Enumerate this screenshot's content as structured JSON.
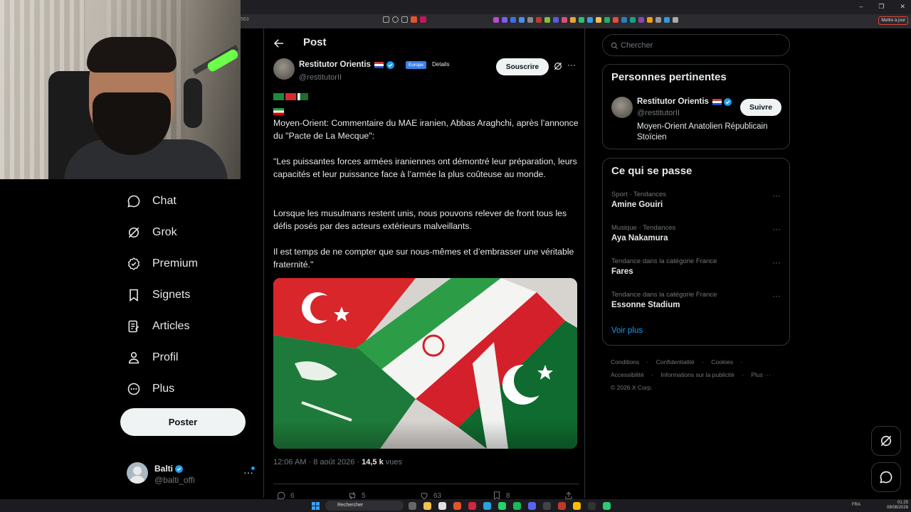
{
  "browser": {
    "url_fragment": "563",
    "update_label": "Mettre à jour",
    "colors": {
      "accent": "#1d9bf0",
      "background": "#000000",
      "border": "#2f3336",
      "muted": "#71767b",
      "text": "#e7e9ea"
    }
  },
  "nav": {
    "items": [
      {
        "label": "Chat",
        "icon": "chat-bubble-icon"
      },
      {
        "label": "Grok",
        "icon": "grok-icon"
      },
      {
        "label": "Premium",
        "icon": "verified-badge-icon"
      },
      {
        "label": "Signets",
        "icon": "bookmark-icon"
      },
      {
        "label": "Articles",
        "icon": "article-icon"
      },
      {
        "label": "Profil",
        "icon": "person-icon"
      },
      {
        "label": "Plus",
        "icon": "more-circle-icon"
      }
    ],
    "post_label": "Poster"
  },
  "account": {
    "name": "Balti",
    "handle": "@balti_offi",
    "more": "···"
  },
  "post": {
    "title": "Post",
    "author": {
      "name": "Restitutor Orientis",
      "handle": "@restitutorII",
      "badge": "Europe",
      "details": "Details"
    },
    "subscribe_label": "Souscrire",
    "more": "···",
    "paragraphs": [
      "Moyen-Orient: Commentaire du MAE iranien, Abbas Araghchi, après l’annonce du \"Pacte de La Mecque\":",
      "\"Les puissantes forces armées iraniennes ont démontré leur préparation, leurs capacités et leur puissance face à l’armée la plus coûteuse au monde.",
      "Lorsque les musulmans restent unis, nous pouvons relever de front tous les défis posés par des acteurs extérieurs malveillants.",
      "Il est temps de ne compter que sur nous-mêmes et d’embrasser une véritable fraternité.\""
    ],
    "timestamp": "12:06 AM · 8 août 2026 · ",
    "views_count": "14,5 k",
    "views_label": " vues",
    "actions": {
      "replies": "6",
      "reposts": "5",
      "likes": "63",
      "bookmarks": "8"
    }
  },
  "sidebar": {
    "search_placeholder": "Chercher",
    "relevant": {
      "title": "Personnes pertinentes",
      "name": "Restitutor Orientis",
      "handle": "@restitutorII",
      "bio": "Moyen-Orient Anatolien Républicain Stoïcien",
      "follow_label": "Suivre"
    },
    "trending": {
      "title": "Ce qui se passe",
      "items": [
        {
          "category": "Sport · Tendances",
          "name": "Amine Gouiri"
        },
        {
          "category": "Musique · Tendances",
          "name": "Aya Nakamura"
        },
        {
          "category": "Tendance dans la catégorie France",
          "name": "Fares"
        },
        {
          "category": "Tendance dans la catégorie France",
          "name": "Essonne Stadium"
        }
      ],
      "more_dots": "···",
      "see_more": "Voir plus"
    },
    "footer": {
      "links": [
        "Conditions",
        "·",
        "Confidentialité",
        "·",
        "Cookies",
        "·",
        "Accessibilité",
        "·",
        "Informations sur la publicité",
        "·",
        "Plus ···"
      ],
      "copyright": "© 2026 X Corp."
    }
  },
  "taskbar": {
    "search_label": "Rechercher",
    "lang": "FRA",
    "time": "01:25",
    "date": "08/08/2026"
  }
}
